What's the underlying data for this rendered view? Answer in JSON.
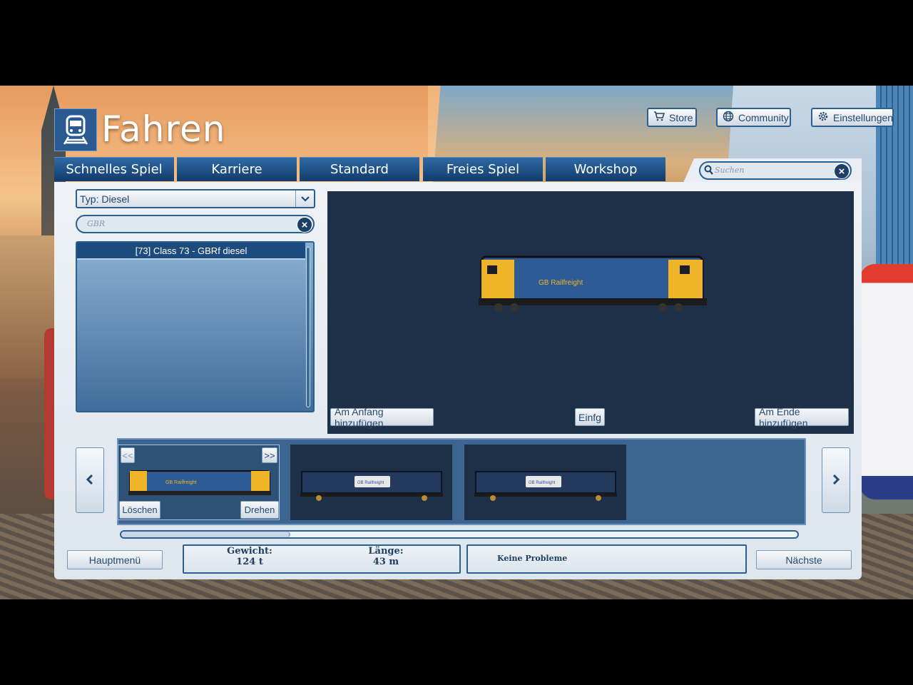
{
  "header": {
    "title": "Fahren"
  },
  "top_buttons": [
    {
      "label": "Store",
      "icon": "cart-icon"
    },
    {
      "label": "Community",
      "icon": "globe-icon"
    },
    {
      "label": "Einstellungen",
      "icon": "gear-icon"
    }
  ],
  "tabs": [
    "Schnelles Spiel",
    "Karriere",
    "Standard",
    "Freies Spiel",
    "Workshop"
  ],
  "search": {
    "placeholder": "Suchen"
  },
  "filter": {
    "type_label": "Typ: Diesel",
    "search_value": "GBR"
  },
  "list": {
    "items": [
      "[73] Class 73 - GBRf diesel"
    ],
    "selected": 0
  },
  "preview": {
    "add_start_label": "Am Anfang hinzufügen",
    "insert_label": "Einfg",
    "add_end_label": "Am Ende hinzufügen",
    "loco_livery": "GB Railfreight"
  },
  "consist": {
    "prev_label": "<<",
    "next_label": ">>",
    "delete_label": "Löschen",
    "rotate_label": "Drehen",
    "cars": [
      {
        "type": "locomotive",
        "livery": "GB Railfreight",
        "active": true
      },
      {
        "type": "wagon",
        "livery": "GB Railfreight",
        "active": false
      },
      {
        "type": "wagon",
        "livery": "GB Railfreight",
        "active": false
      }
    ],
    "scroll_fraction": 0.25
  },
  "footer": {
    "main_menu_label": "Hauptmenü",
    "weight_label": "Gewicht:",
    "weight_value": "124 t",
    "length_label": "Länge:",
    "length_value": "43 m",
    "status": "Keine Probleme",
    "next_label": "Nächste"
  },
  "colors": {
    "accent": "#2b5f8f",
    "tab_bg": "#1d4a7c",
    "preview_bg": "#1d3047",
    "loco_yellow": "#f0b429",
    "loco_blue": "#2e5b96"
  }
}
